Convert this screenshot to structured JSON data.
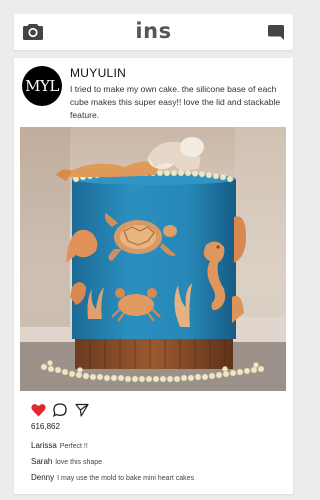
{
  "app": {
    "brand": "ins"
  },
  "icons": {
    "camera": "camera-icon",
    "direct": "message-icon",
    "like": "heart-icon",
    "comment": "comment-icon",
    "share": "send-icon"
  },
  "colors": {
    "heart": "#e0282e",
    "background": "#ececec",
    "avatar": "#000000"
  },
  "post": {
    "avatar_text": "MYL",
    "username": "MUYULIN",
    "caption": "I tried to make my own cake. the silicone base of each cube makes this super easy!! love the lid and stackable feature.",
    "image_alt": "Ocean themed blue cake with mermaid, turtle, crab and seahorse decorations",
    "liked": true,
    "likes": "616,862",
    "comments": [
      {
        "user": "Larissa",
        "text": "Perfect !!"
      },
      {
        "user": "Sarah",
        "text": "love this shape"
      },
      {
        "user": "Denny",
        "text": "I may use the mold to bake mini heart cakes"
      }
    ]
  }
}
